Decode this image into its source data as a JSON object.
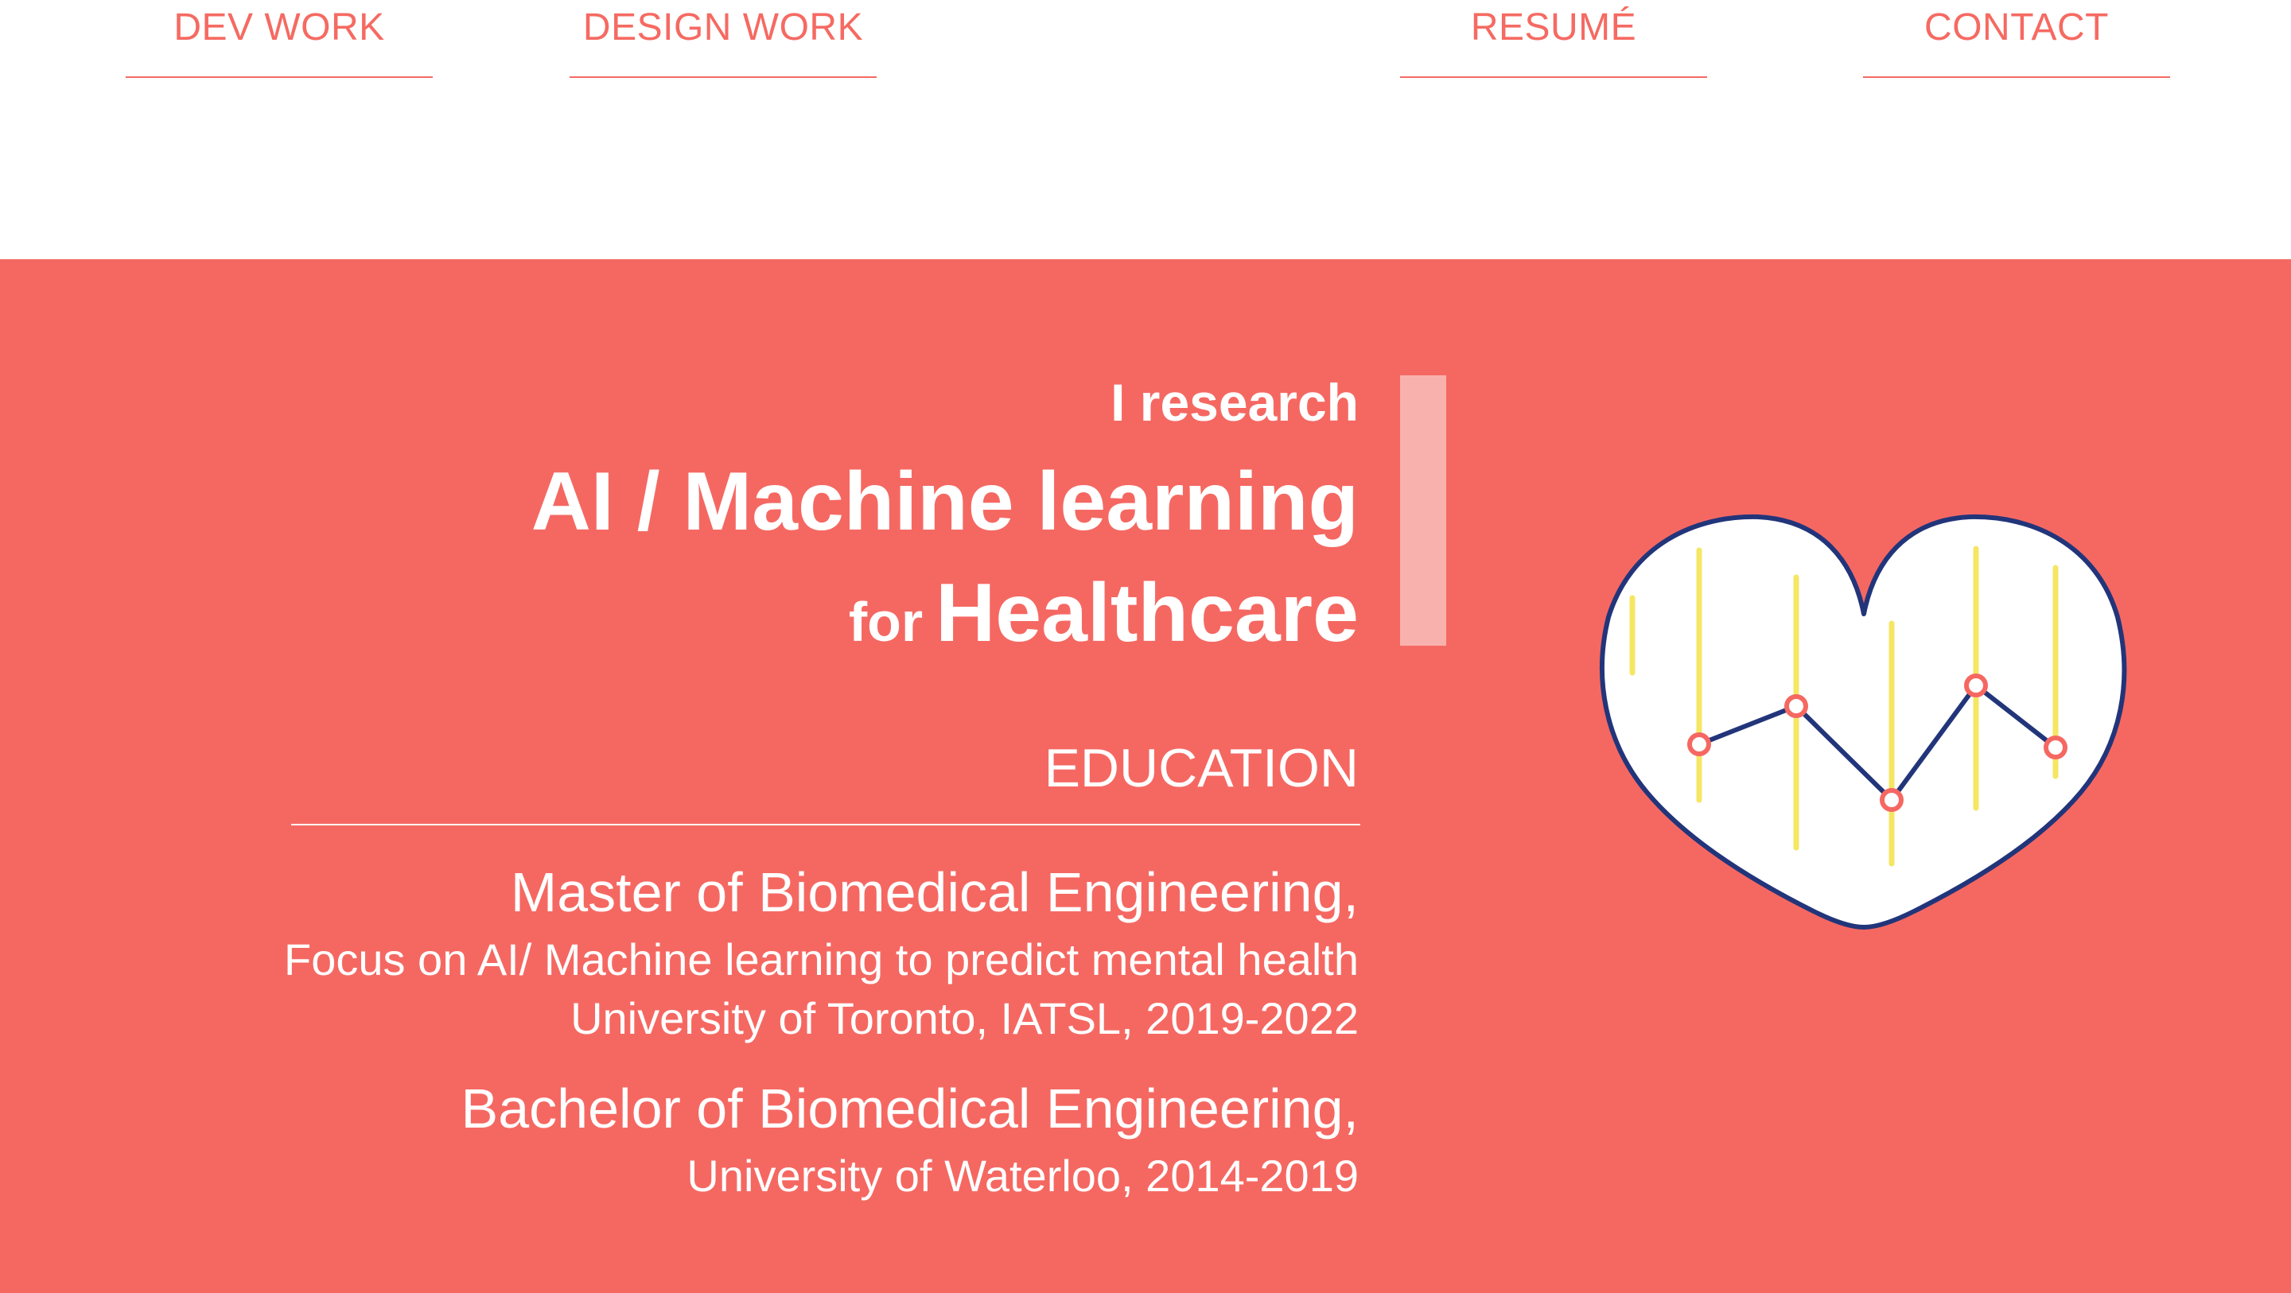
{
  "nav": {
    "items": [
      {
        "label": "DEV WORK"
      },
      {
        "label": "DESIGN WORK"
      },
      {
        "label": "RESUMÉ"
      },
      {
        "label": "CONTACT"
      }
    ]
  },
  "hero": {
    "intro": "I research",
    "field": "AI / Machine learning",
    "for_word": "for",
    "domain": "Healthcare"
  },
  "education": {
    "heading": "EDUCATION",
    "degrees": [
      {
        "title": "Master of Biomedical Engineering,",
        "focus": "Focus on AI/ Machine learning to predict mental health",
        "school": "University of Toronto, IATSL, 2019-2022"
      },
      {
        "title": "Bachelor of Biomedical Engineering,",
        "school": "University of Waterloo, 2014-2019"
      }
    ]
  },
  "illustration": {
    "icon": "heart-chart-icon",
    "colors": {
      "outline": "#22357a",
      "bars": "#f5e663",
      "points": "#f56862",
      "fill": "#ffffff"
    }
  },
  "colors": {
    "accent": "#f56862",
    "accent_bar": "#f9b1ad",
    "background": "#ffffff"
  }
}
